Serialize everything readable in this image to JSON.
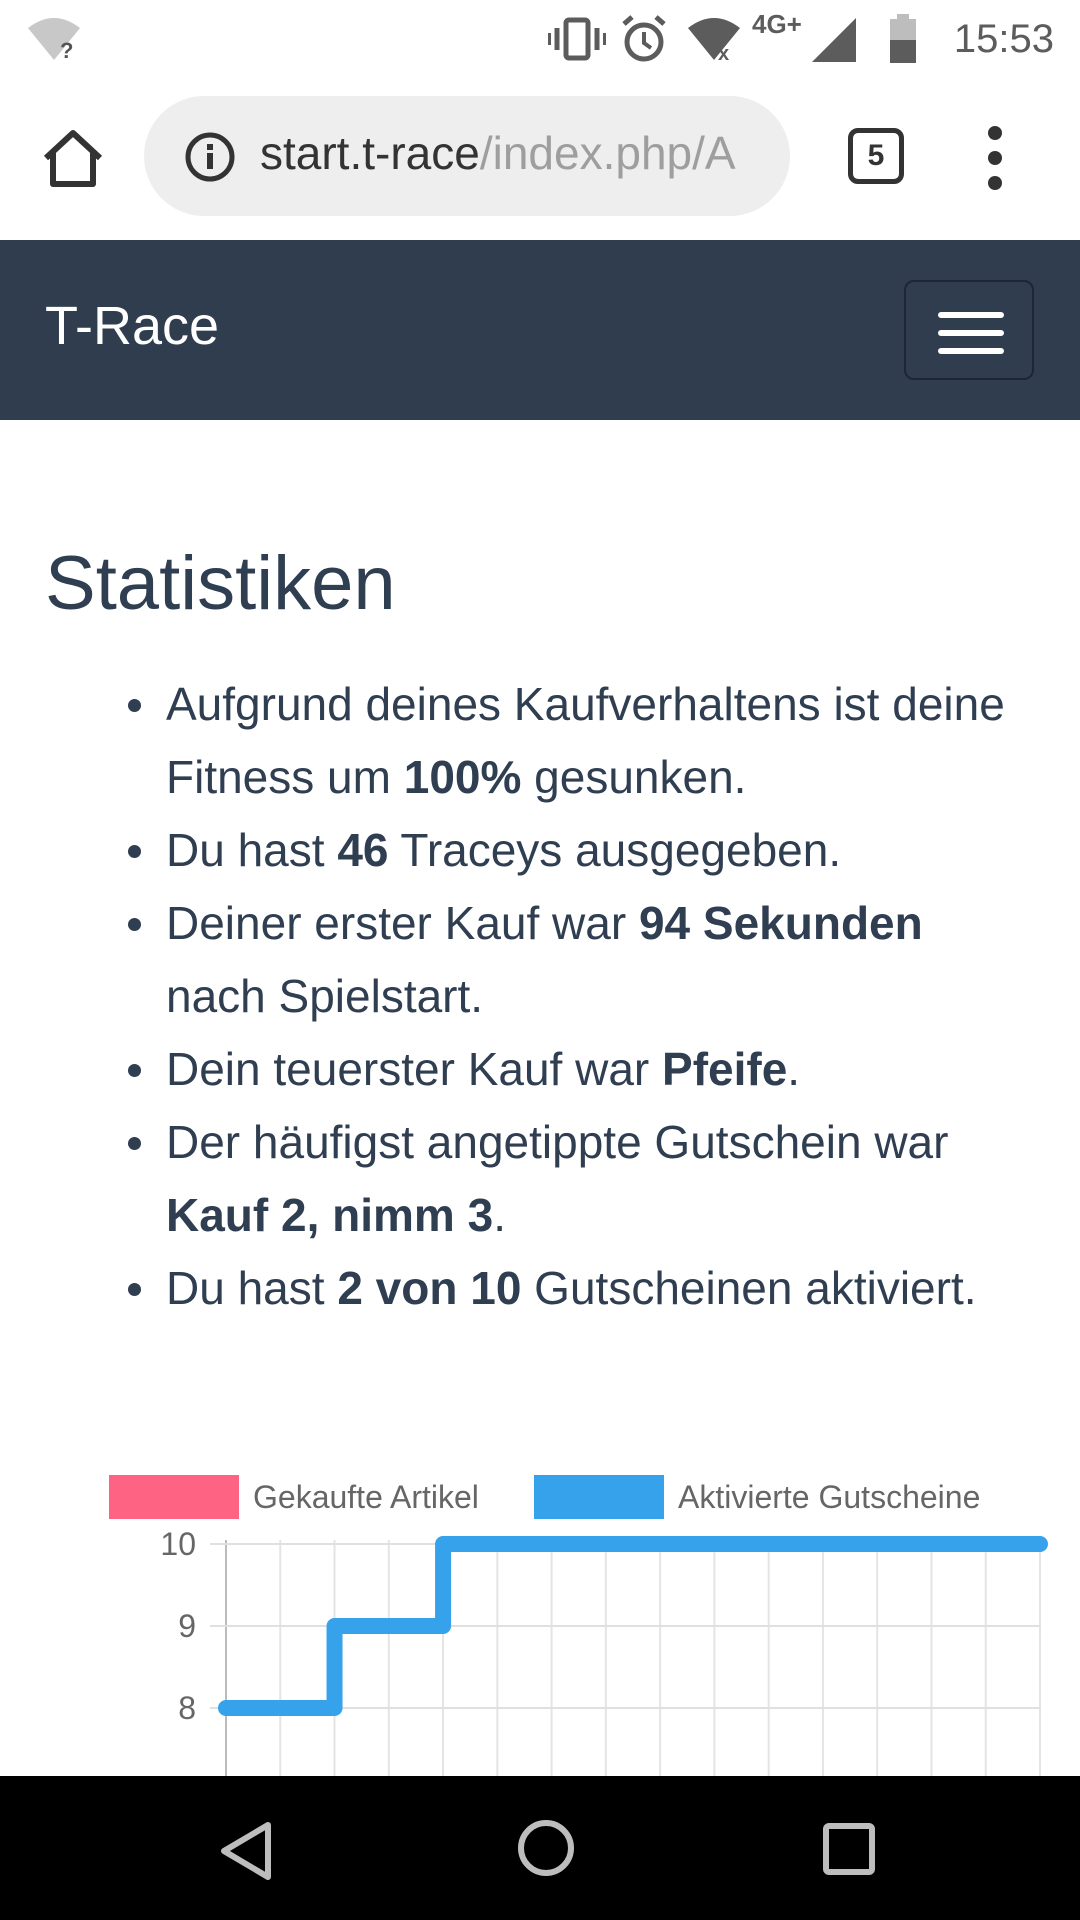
{
  "status_bar": {
    "time": "15:53",
    "network": "4G+",
    "icons": [
      "wifi-unknown-icon",
      "vibrate-icon",
      "alarm-icon",
      "wifi-off-icon",
      "signal-icon",
      "battery-icon"
    ]
  },
  "browser": {
    "url_host": "start.t-race",
    "url_path": "/index.php/A",
    "tab_count": "5"
  },
  "navbar": {
    "brand": "T-Race"
  },
  "page": {
    "title": "Statistiken",
    "items": [
      {
        "pre": "Aufgrund deines Kaufverhaltens ist deine Fitness um ",
        "bold": "100%",
        "post": " gesunken."
      },
      {
        "pre": "Du hast ",
        "bold": "46",
        "post": " Traceys ausgegeben."
      },
      {
        "pre": "Deiner erster Kauf war ",
        "bold": "94 Sekunden",
        "post": " nach Spielstart."
      },
      {
        "pre": "Dein teuerster Kauf war ",
        "bold": "Pfeife",
        "post": "."
      },
      {
        "pre": "Der häufigst angetippte Gutschein war ",
        "bold": "Kauf 2, nimm 3",
        "post": "."
      },
      {
        "pre": "Du hast ",
        "bold": "2 von 10",
        "post": " Gutscheinen aktiviert."
      }
    ]
  },
  "chart_data": {
    "type": "line",
    "legend_position": "top",
    "grid": true,
    "series": [
      {
        "name": "Gekaufte Artikel",
        "color": "#ff6384",
        "values": []
      },
      {
        "name": "Aktivierte Gutscheine",
        "color": "#36a2eb",
        "stepped": true,
        "values": [
          8,
          8,
          9,
          9,
          10,
          10,
          10,
          10,
          10,
          10,
          10,
          10,
          10,
          10,
          10,
          10
        ]
      }
    ],
    "y_ticks": [
      "10",
      "9",
      "8"
    ],
    "ylim_visible": [
      8,
      10
    ]
  }
}
